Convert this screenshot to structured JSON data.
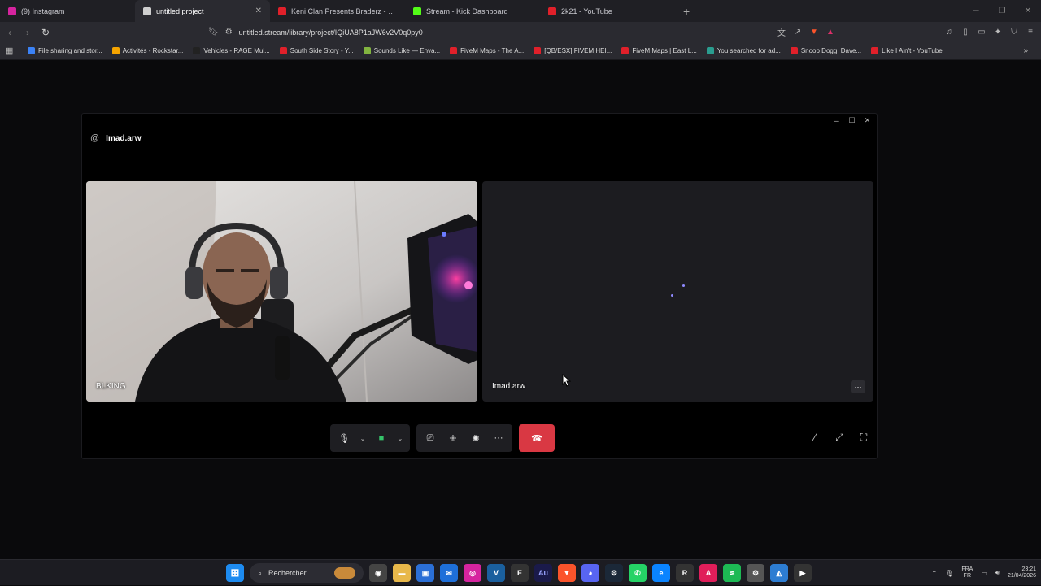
{
  "browser": {
    "tabs": [
      {
        "title": "(9) Instagram",
        "favicon_color": "#d6249f",
        "active": false
      },
      {
        "title": "untitled project",
        "favicon_color": "#cfcfcf",
        "active": true
      },
      {
        "title": "Keni Clan Presents Braderz - F'Dlam",
        "favicon_color": "#e0202a",
        "active": false
      },
      {
        "title": "Stream - Kick Dashboard",
        "favicon_color": "#53fc18",
        "active": false
      },
      {
        "title": "2k21 - YouTube",
        "favicon_color": "#e0202a",
        "active": false
      }
    ],
    "url": "untitled.stream/library/project/IQiUA8P1aJW6v2V0q0py0",
    "bookmarks": [
      {
        "label": "File sharing and stor...",
        "color": "#3b82f6"
      },
      {
        "label": "Activités - Rockstar...",
        "color": "#f5a400"
      },
      {
        "label": "Vehicles - RAGE Mul...",
        "color": "#222222"
      },
      {
        "label": "South Side Story - Y...",
        "color": "#e0202a"
      },
      {
        "label": "Sounds Like — Enva...",
        "color": "#82b440"
      },
      {
        "label": "FiveM Maps - The A...",
        "color": "#e0202a"
      },
      {
        "label": "[QB/ESX] FIVEM HEI...",
        "color": "#e0202a"
      },
      {
        "label": "FiveM Maps | East L...",
        "color": "#e0202a"
      },
      {
        "label": "You searched for ad...",
        "color": "#2a9d8f"
      },
      {
        "label": "Snoop Dogg, Dave...",
        "color": "#e0202a"
      },
      {
        "label": "Like I Ain't - YouTube",
        "color": "#e0202a"
      }
    ]
  },
  "call": {
    "title_prefix": "@",
    "title": "Imad.arw",
    "local_participant": "BLKING",
    "remote_participant": "Imad.arw",
    "remote_more_label": "···",
    "hangup_color": "#d93843"
  },
  "taskbar": {
    "search_placeholder": "Rechercher",
    "language_top": "FRA",
    "language_bottom": "FR",
    "time": "23:21",
    "date": "21/04/2026"
  }
}
